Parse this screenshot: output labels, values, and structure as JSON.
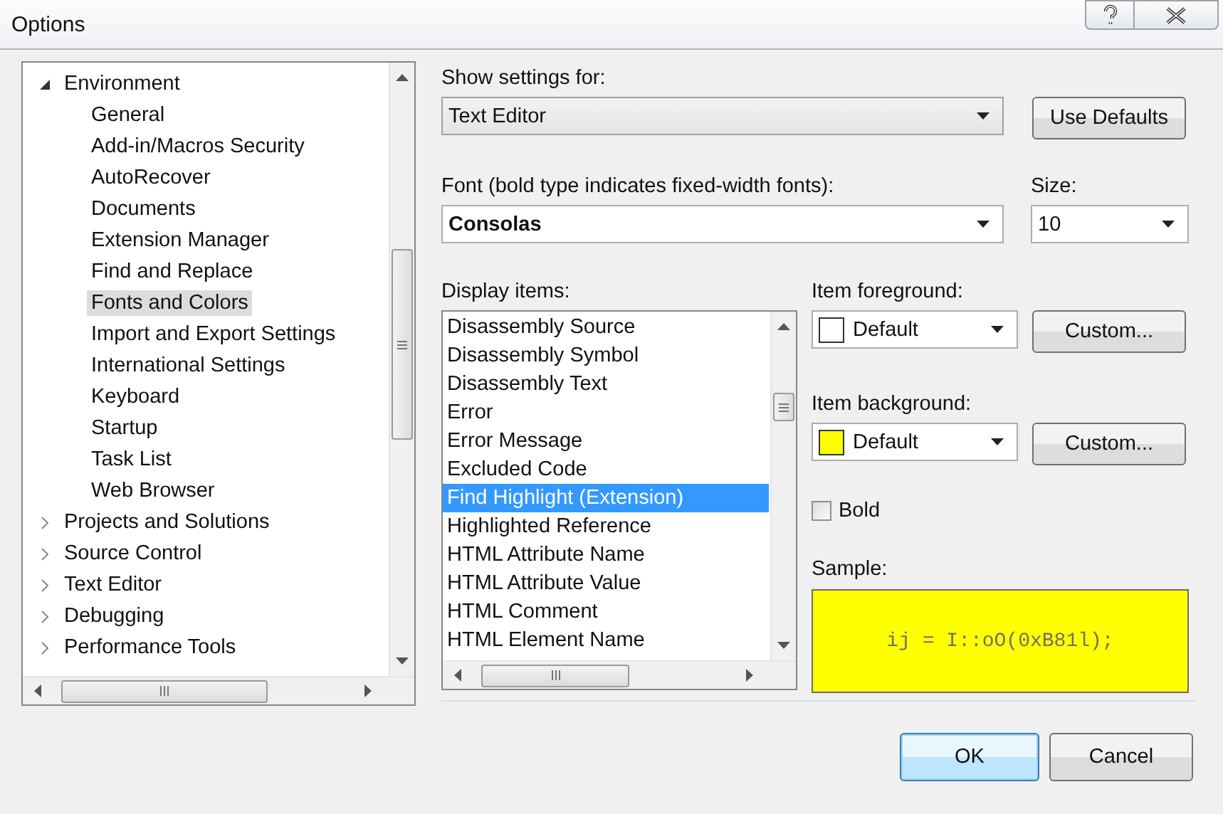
{
  "window": {
    "title": "Options"
  },
  "tree": [
    {
      "label": "Environment",
      "expanded": true,
      "selected": false,
      "children": [
        {
          "label": "General",
          "selected": false
        },
        {
          "label": "Add-in/Macros Security",
          "selected": false
        },
        {
          "label": "AutoRecover",
          "selected": false
        },
        {
          "label": "Documents",
          "selected": false
        },
        {
          "label": "Extension Manager",
          "selected": false
        },
        {
          "label": "Find and Replace",
          "selected": false
        },
        {
          "label": "Fonts and Colors",
          "selected": true
        },
        {
          "label": "Import and Export Settings",
          "selected": false
        },
        {
          "label": "International Settings",
          "selected": false
        },
        {
          "label": "Keyboard",
          "selected": false
        },
        {
          "label": "Startup",
          "selected": false
        },
        {
          "label": "Task List",
          "selected": false
        },
        {
          "label": "Web Browser",
          "selected": false
        }
      ]
    },
    {
      "label": "Projects and Solutions",
      "expanded": false,
      "selected": false
    },
    {
      "label": "Source Control",
      "expanded": false,
      "selected": false
    },
    {
      "label": "Text Editor",
      "expanded": false,
      "selected": false
    },
    {
      "label": "Debugging",
      "expanded": false,
      "selected": false
    },
    {
      "label": "Performance Tools",
      "expanded": false,
      "selected": false
    }
  ],
  "show_settings_for": {
    "label": "Show settings for:",
    "value": "Text Editor"
  },
  "use_defaults_button": "Use Defaults",
  "font": {
    "label": "Font (bold type indicates fixed-width fonts):",
    "value": "Consolas"
  },
  "size": {
    "label": "Size:",
    "value": "10"
  },
  "display_items": {
    "label": "Display items:",
    "items": [
      {
        "label": "Disassembly Source",
        "selected": false
      },
      {
        "label": "Disassembly Symbol",
        "selected": false
      },
      {
        "label": "Disassembly Text",
        "selected": false
      },
      {
        "label": "Error",
        "selected": false
      },
      {
        "label": "Error Message",
        "selected": false
      },
      {
        "label": "Excluded Code",
        "selected": false
      },
      {
        "label": "Find Highlight (Extension)",
        "selected": true
      },
      {
        "label": "Highlighted Reference",
        "selected": false
      },
      {
        "label": "HTML Attribute Name",
        "selected": false
      },
      {
        "label": "HTML Attribute Value",
        "selected": false
      },
      {
        "label": "HTML Comment",
        "selected": false
      },
      {
        "label": "HTML Element Name",
        "selected": false
      }
    ]
  },
  "item_foreground": {
    "label": "Item foreground:",
    "value": "Default",
    "color": "#ffffff",
    "button": "Custom..."
  },
  "item_background": {
    "label": "Item background:",
    "value": "Default",
    "color": "#ffff00",
    "button": "Custom..."
  },
  "bold": {
    "label": "Bold",
    "checked": false
  },
  "sample": {
    "label": "Sample:",
    "text": "ij = I::oO(0xB81l);"
  },
  "buttons": [
    {
      "label": "OK",
      "default": true
    },
    {
      "label": "Cancel",
      "default": false
    }
  ]
}
